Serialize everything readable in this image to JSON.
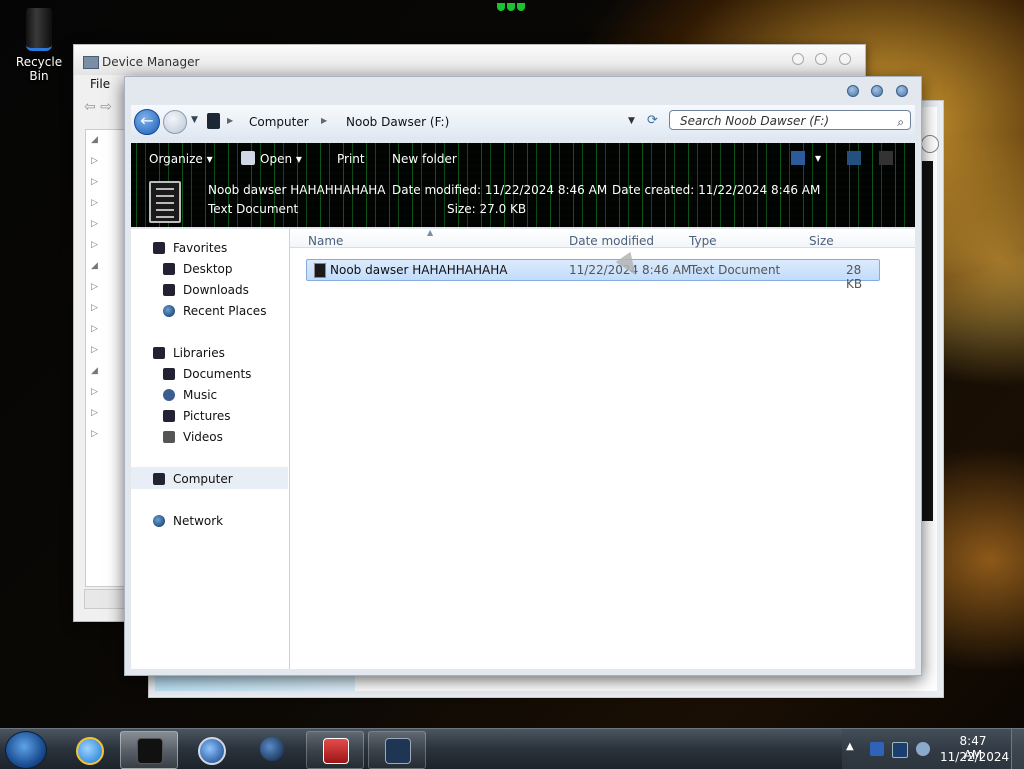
{
  "desktop": {
    "recycle_bin_label": "Recycle Bin"
  },
  "device_manager": {
    "title": "Device Manager",
    "menu_file": "File"
  },
  "explorer": {
    "breadcrumbs": [
      "Computer",
      "Noob Dawser (F:)"
    ],
    "search_placeholder": "Search Noob Dawser (F:)",
    "toolbar": {
      "organize": "Organize",
      "open": "Open",
      "print": "Print",
      "new_folder": "New folder"
    },
    "details": {
      "name": "Noob dawser HAHAHHAHAHA",
      "type": "Text Document",
      "date_modified": "Date modified: 11/22/2024 8:46 AM",
      "date_created": "Date created: 11/22/2024 8:46 AM",
      "size": "Size: 27.0 KB"
    },
    "nav": {
      "favorites": "Favorites",
      "desktop": "Desktop",
      "downloads": "Downloads",
      "recent_places": "Recent Places",
      "libraries": "Libraries",
      "documents": "Documents",
      "music": "Music",
      "pictures": "Pictures",
      "videos": "Videos",
      "computer": "Computer",
      "network": "Network"
    },
    "columns": {
      "name": "Name",
      "date_modified": "Date modified",
      "type": "Type",
      "size": "Size"
    },
    "file": {
      "name": "Noob dawser HAHAHHAHAHA",
      "date_modified": "11/22/2024 8:46 AM",
      "type": "Text Document",
      "size": "28 KB"
    }
  },
  "taskbar": {
    "time": "8:47 AM",
    "date": "11/22/2024",
    "tray_expand": "▲"
  },
  "colors": {
    "accent_selection": "#c1dcfc",
    "taskbar": "#2a323b",
    "matrix_green": "#19c431"
  }
}
